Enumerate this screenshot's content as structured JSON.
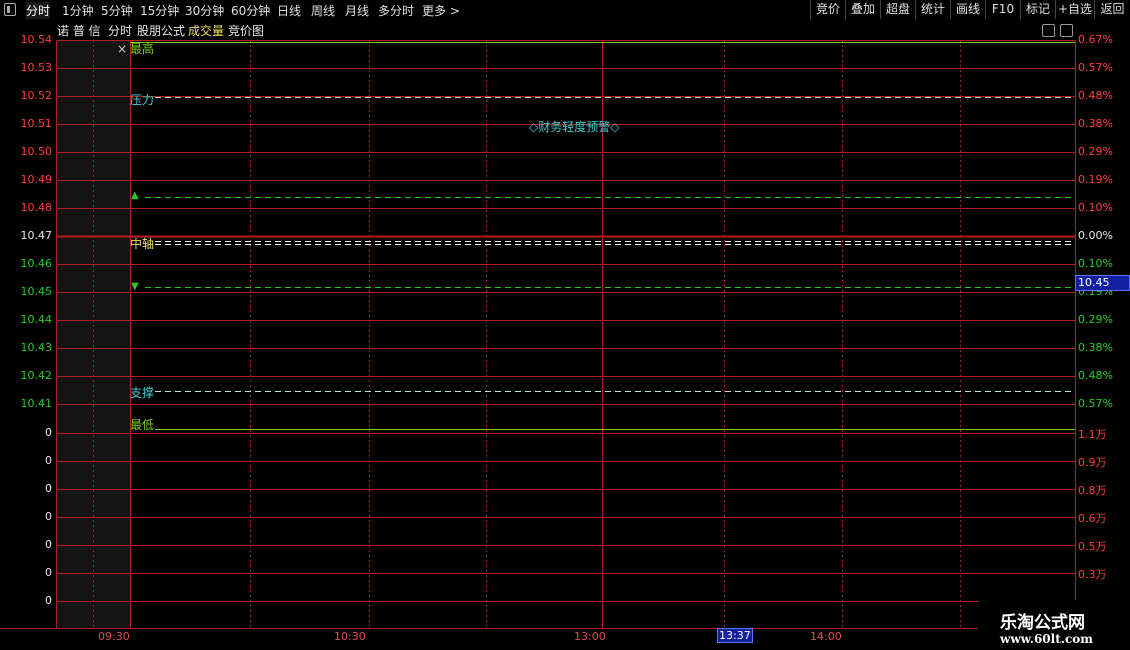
{
  "toolbar": {
    "periods": [
      "分时",
      "1分钟",
      "5分钟",
      "15分钟",
      "30分钟",
      "60分钟",
      "日线",
      "周线",
      "月线",
      "多分时",
      "更多 >"
    ],
    "active_period": "分时",
    "right_buttons": [
      "竞价",
      "叠加",
      "超盘",
      "统计",
      "画线",
      "F10",
      "标记",
      "+自选",
      "返回"
    ]
  },
  "subtitle": {
    "stock_name": "诺 普 信",
    "view": "分时",
    "formula": "股朋公式",
    "volume_tab": "成交量",
    "auction_tab": "竞价图"
  },
  "chart": {
    "price_labels": [
      "10.54",
      "10.53",
      "10.52",
      "10.51",
      "10.50",
      "10.49",
      "10.48",
      "10.47",
      "10.46",
      "10.45",
      "10.44",
      "10.43",
      "10.42",
      "10.41"
    ],
    "price_colors": {
      "up": "#ff3c3c",
      "neutral": "#e8e8e8",
      "down": "#20d020"
    },
    "percent_labels": [
      "0.67%",
      "0.57%",
      "0.48%",
      "0.38%",
      "0.29%",
      "0.19%",
      "0.10%",
      "0.00%",
      "0.10%",
      "0.19%",
      "0.29%",
      "0.38%",
      "0.48%",
      "0.57%"
    ],
    "volume_left_labels": [
      "0",
      "0",
      "0",
      "0",
      "0",
      "0",
      "0"
    ],
    "volume_right_labels": [
      "1.1万",
      "0.9万",
      "0.8万",
      "0.6万",
      "0.5万",
      "0.3万"
    ],
    "current_price_tag": "10.45",
    "annotations": {
      "high": "最高",
      "resistance": "压力",
      "warning": "◇财务轻度预警◇",
      "axis": "中轴",
      "support": "支撑",
      "low": "最低",
      "up_arrow": "▲",
      "down_arrow": "▼",
      "close": "×"
    },
    "time_labels": [
      "09:30",
      "10:30",
      "13:00",
      "13:37",
      "14:00"
    ],
    "highlighted_time": "13:37"
  },
  "watermark": {
    "title": "乐淘公式网",
    "url": "www.60lt.com"
  },
  "colors": {
    "grid": "#b41e1e",
    "high_low_line": "#7cd01a",
    "resistance_line": "#bfe0e0",
    "signal_line": "#22cc22",
    "axis_line": "#ffffff",
    "cyan_text": "#40d0d0",
    "yellow_text": "#f0e060"
  }
}
